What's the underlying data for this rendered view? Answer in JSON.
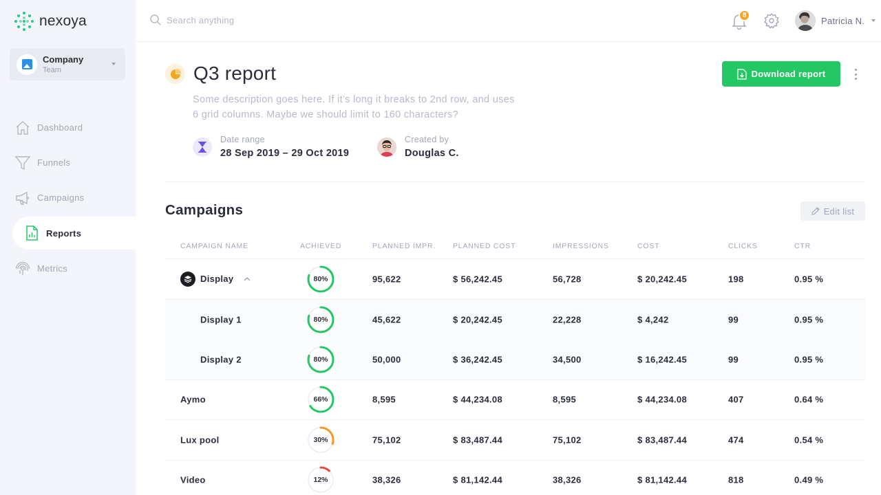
{
  "brand": {
    "name": "nexoya",
    "accent": "#25c764"
  },
  "company": {
    "name": "Company",
    "sub": "Team"
  },
  "nav": [
    {
      "label": "Dashboard",
      "icon": "home-icon",
      "active": false
    },
    {
      "label": "Funnels",
      "icon": "funnel-icon",
      "active": false
    },
    {
      "label": "Campaigns",
      "icon": "megaphone-icon",
      "active": false
    },
    {
      "label": "Reports",
      "icon": "report-icon",
      "active": true
    },
    {
      "label": "Metrics",
      "icon": "fingerprint-icon",
      "active": false
    }
  ],
  "topbar": {
    "search_placeholder": "Search anything",
    "notifications": "8",
    "user_name": "Patricia N."
  },
  "report": {
    "title": "Q3 report",
    "description": "Some description goes here. If it’s long it breaks to 2nd row, and uses 6 grid columns. Maybe we should limit to 160 characters?",
    "download_label": "Download report",
    "date_range_label": "Date range",
    "date_range_value": "28 Sep 2019 – 29 Oct 2019",
    "created_by_label": "Created by",
    "created_by_value": "Douglas C."
  },
  "campaigns": {
    "title": "Campaigns",
    "edit_label": "Edit list",
    "columns": [
      "CAMPAIGN NAME",
      "ACHIEVED",
      "PLANNED IMPR.",
      "PLANNED COST",
      "IMPRESSIONS",
      "COST",
      "CLICKS",
      "CTR"
    ],
    "rows": [
      {
        "name": "Display",
        "achieved_label": "80%",
        "achieved": 0.8,
        "color": "#25c764",
        "planned_impr": "95,622",
        "planned_cost": "$ 56,242.45",
        "impressions": "56,728",
        "cost": "$ 20,242.45",
        "clicks": "198",
        "ctr": "0.95 %"
      },
      {
        "name": "Display 1",
        "achieved_label": "80%",
        "achieved": 0.8,
        "color": "#25c764",
        "planned_impr": "45,622",
        "planned_cost": "$ 20,242.45",
        "impressions": "22,228",
        "cost": "$ 4,242",
        "clicks": "99",
        "ctr": "0.95 %"
      },
      {
        "name": "Display 2",
        "achieved_label": "80%",
        "achieved": 0.8,
        "color": "#25c764",
        "planned_impr": "50,000",
        "planned_cost": "$ 36,242.45",
        "impressions": "34,500",
        "cost": "$ 16,242.45",
        "clicks": "99",
        "ctr": "0.95 %"
      },
      {
        "name": "Aymo",
        "achieved_label": "66%",
        "achieved": 0.66,
        "color": "#25c764",
        "planned_impr": "8,595",
        "planned_cost": "$ 44,234.08",
        "impressions": "8,595",
        "cost": "$ 44,234.08",
        "clicks": "407",
        "ctr": "0.64 %"
      },
      {
        "name": "Lux pool",
        "achieved_label": "30%",
        "achieved": 0.3,
        "color": "#f59a23",
        "planned_impr": "75,102",
        "planned_cost": "$ 83,487.44",
        "impressions": "75,102",
        "cost": "$ 83,487.44",
        "clicks": "474",
        "ctr": "0.54 %"
      },
      {
        "name": "Video",
        "achieved_label": "12%",
        "achieved": 0.12,
        "color": "#e8453c",
        "planned_impr": "38,326",
        "planned_cost": "$ 81,142.44",
        "impressions": "38,326",
        "cost": "$ 81,142.44",
        "clicks": "818",
        "ctr": "0.49 %"
      }
    ]
  }
}
